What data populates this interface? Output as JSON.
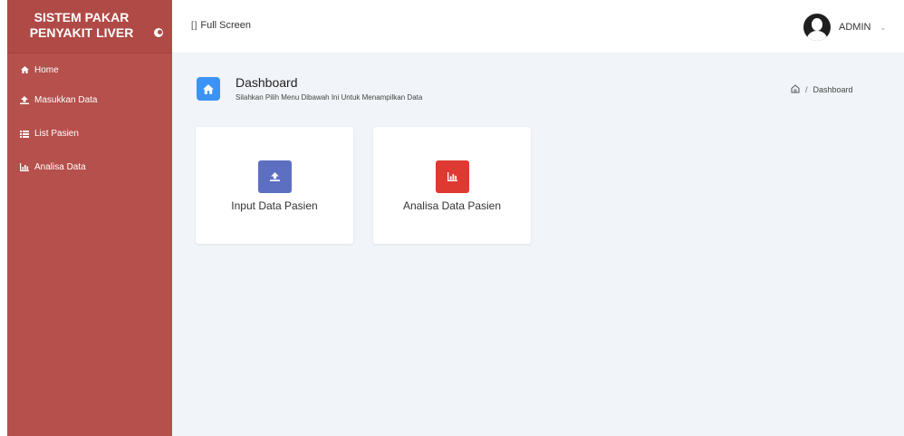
{
  "brand": {
    "title": "SISTEM PAKAR PENYAKIT LIVER",
    "toggle_icon": "toggle-icon"
  },
  "sidebar": {
    "items": [
      {
        "label": "Home",
        "icon": "home-icon"
      },
      {
        "label": "Masukkan Data",
        "icon": "upload-icon"
      },
      {
        "label": "List Pasien",
        "icon": "list-icon"
      },
      {
        "label": "Analisa Data",
        "icon": "bar-chart-icon"
      }
    ]
  },
  "topbar": {
    "fullscreen_icon": "[]",
    "fullscreen_label": "Full Screen",
    "user_name": "ADMIN",
    "caret": "⌄"
  },
  "page": {
    "title": "Dashboard",
    "subtitle": "Silahkan Pilih Menu Dibawah Ini Untuk Menampilkan Data",
    "breadcrumb": {
      "separator": "/",
      "current": "Dashboard"
    }
  },
  "cards": [
    {
      "label": "Input Data Pasien",
      "icon": "upload-icon",
      "color": "#5d6fc1"
    },
    {
      "label": "Analisa Data Pasien",
      "icon": "bar-chart-icon",
      "color": "#de3a32"
    }
  ],
  "colors": {
    "sidebar": "#b5504c",
    "brand_bar": "#b04a46",
    "page_head_icon": "#3b93f5",
    "main_bg": "#f1f4f8"
  }
}
